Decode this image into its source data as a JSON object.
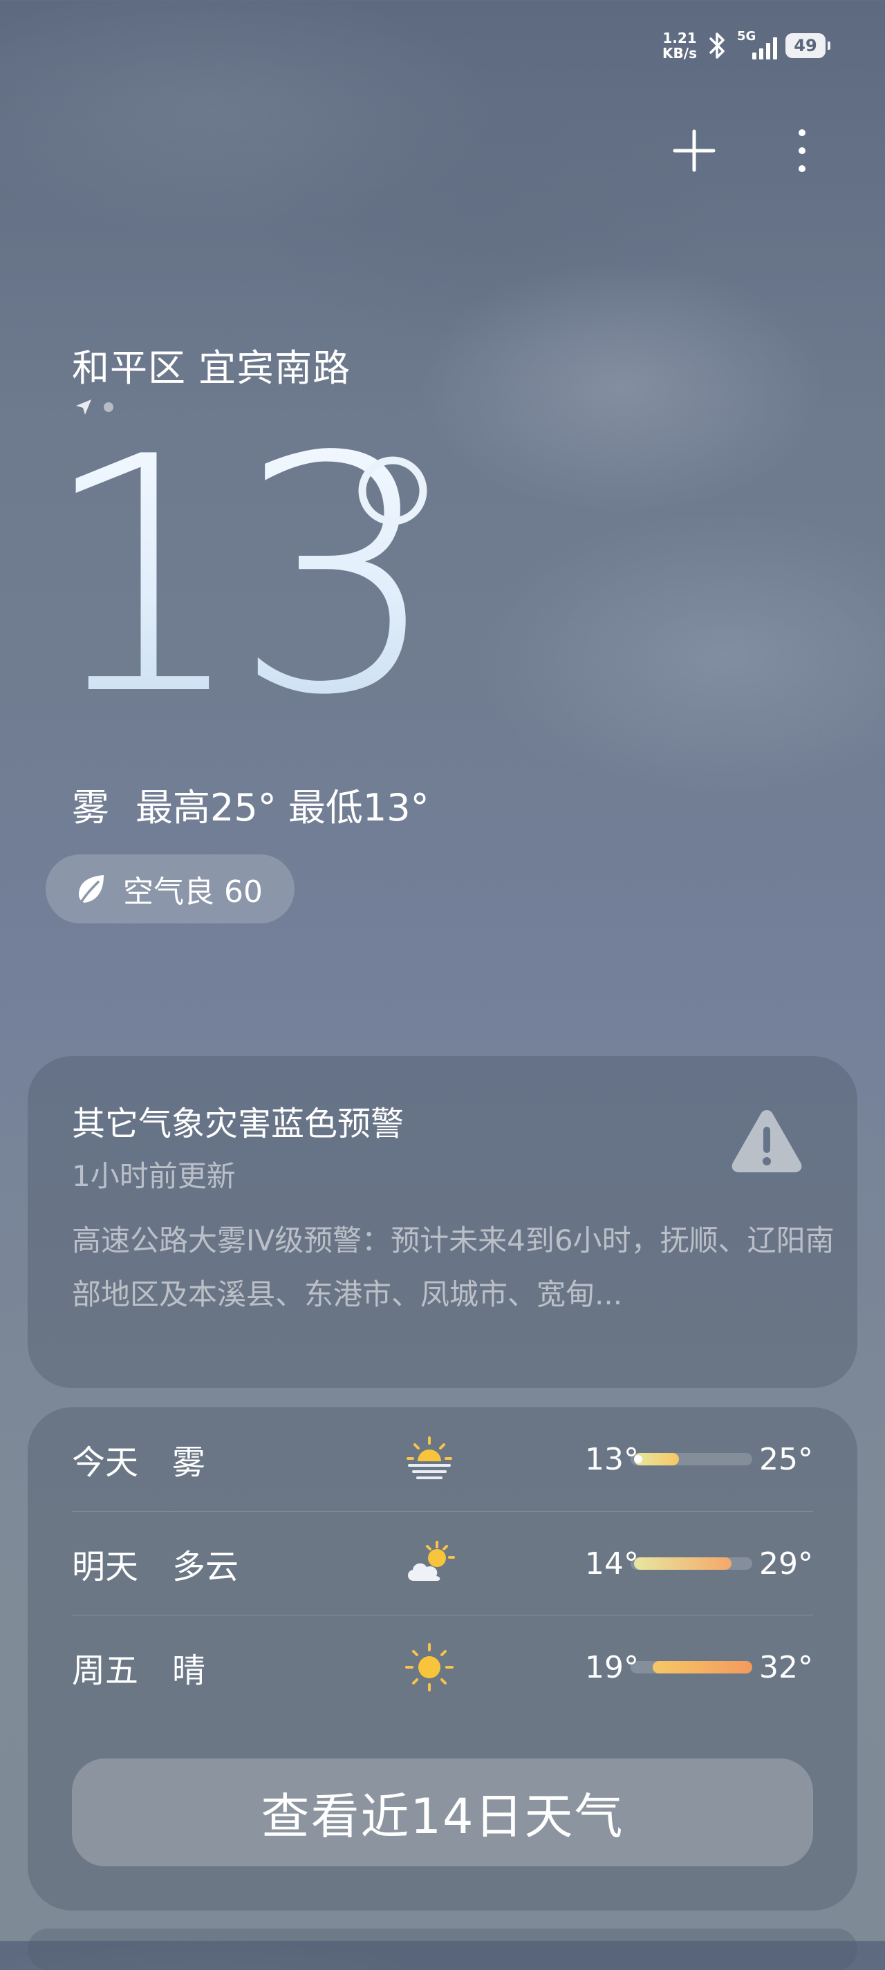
{
  "status_bar": {
    "network_speed_value": "1.21",
    "network_speed_unit": "KB/s",
    "network_type": "5G",
    "battery_level": "49",
    "icons": [
      "bluetooth-icon",
      "signal-icon",
      "battery-icon"
    ]
  },
  "header": {
    "add_city_icon": "plus-icon",
    "more_icon": "more-vertical-icon"
  },
  "location": {
    "name": "和平区 宜宾南路",
    "indicator_icon": "location-arrow-icon",
    "page_dots": 1
  },
  "current": {
    "temperature": "13",
    "degree_symbol": "°",
    "condition": "雾",
    "high_low": "最高25° 最低13°"
  },
  "air_quality": {
    "icon": "leaf-icon",
    "label": "空气良 60"
  },
  "alert": {
    "title": "其它气象灾害蓝色预警",
    "updated": "1小时前更新",
    "body": "高速公路大雾IV级预警：预计未来4到6小时，抚顺、辽阳南部地区及本溪县、东港市、凤城市、宽甸...",
    "icon": "warning-triangle-icon"
  },
  "forecast": {
    "days": [
      {
        "day": "今天",
        "condition": "雾",
        "icon": "fog-sun-icon",
        "low": "13°",
        "high": "25°",
        "range_start": 0.03,
        "range_end": 0.4,
        "show_current": true,
        "colors": [
          "#e7e6a0",
          "#f6c866"
        ]
      },
      {
        "day": "明天",
        "condition": "多云",
        "icon": "partly-cloudy-icon",
        "low": "14°",
        "high": "29°",
        "range_start": 0.03,
        "range_end": 0.83,
        "show_current": false,
        "colors": [
          "#e7e6a0",
          "#f4a86a"
        ]
      },
      {
        "day": "周五",
        "condition": "晴",
        "icon": "sun-icon",
        "low": "19°",
        "high": "32°",
        "range_start": 0.18,
        "range_end": 1.0,
        "show_current": false,
        "colors": [
          "#f6c866",
          "#f49a5e"
        ]
      }
    ],
    "button_label": "查看近14日天气"
  }
}
